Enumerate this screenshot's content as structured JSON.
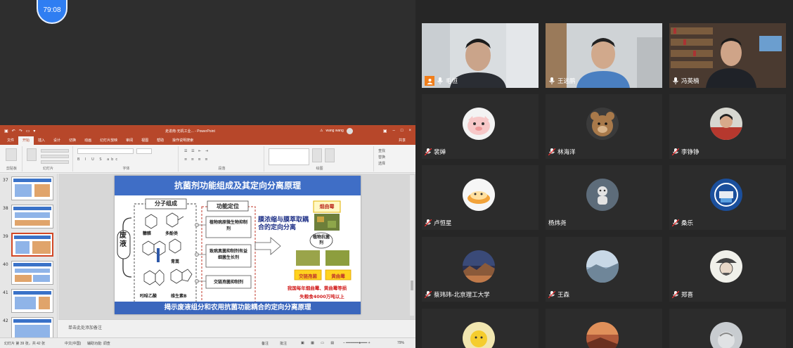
{
  "timer": "79:08",
  "ppt": {
    "doc_title": "走进南·无机工业...  -  PowerPoint",
    "account": "wang wang",
    "tabs": [
      "文件",
      "开始",
      "插入",
      "设计",
      "切换",
      "动画",
      "幻灯片放映",
      "审阅",
      "视图",
      "帮助",
      "操作说明搜索"
    ],
    "share_label": "共享",
    "groups": [
      "剪贴板",
      "幻灯片",
      "字体",
      "段落",
      "绘图"
    ],
    "find_label": "查找",
    "replace_label": "替换",
    "select_label": "选择",
    "slide_numbers": [
      "37",
      "38",
      "39",
      "40",
      "41",
      "42"
    ],
    "slide": {
      "title": "抗菌剂功能组成及其定向分离原理",
      "footer": "揭示废液组分和农用抗菌功能耦合的定向分离原理",
      "waste_label": "废液",
      "molecular_header": "分子组成",
      "mol_labels": [
        "糠醛",
        "多酚类",
        "青蒿",
        "吲哚乙酸",
        "维生素B"
      ],
      "function_header": "功能定位",
      "functions": [
        "植物病原微生物抑制剂",
        "致病真菌抑制剂有益细菌生长剂",
        "交链孢菌抑制剂"
      ],
      "process_text": "膜浓缩与膜萃取耦合的定向分离",
      "product_label": "烟曲霉",
      "antibacterial_label": "植物抗菌剂",
      "fungi": [
        "交链孢菌",
        "黄曲霉"
      ],
      "loss_text_1": "我国每年烟曲霉、黄曲霉等损",
      "loss_text_2": "失粮食4000万吨以上"
    },
    "note_placeholder": "单击此处添加备注",
    "status": {
      "slide_pos": "幻灯片 第 39 张，共 42 张",
      "lang": "中文(中国)",
      "accessibility": "辅助功能: 调查",
      "notes": "备注",
      "comments": "批注",
      "zoom": "79%"
    }
  },
  "participants": [
    {
      "name": "毛恒",
      "type": "video"
    },
    {
      "name": "王远鹏",
      "type": "video"
    },
    {
      "name": "冯英楠",
      "type": "video"
    },
    {
      "name": "裴婵",
      "type": "avatar"
    },
    {
      "name": "林海洋",
      "type": "avatar"
    },
    {
      "name": "李铮铮",
      "type": "avatar"
    },
    {
      "name": "卢恒星",
      "type": "avatar"
    },
    {
      "name": "杨炜尧",
      "type": "avatar"
    },
    {
      "name": "桑乐",
      "type": "avatar"
    },
    {
      "name": "蔡玮玮-北京理工大学",
      "type": "avatar"
    },
    {
      "name": "王森",
      "type": "avatar"
    },
    {
      "name": "郑喜",
      "type": "avatar"
    }
  ],
  "colors": {
    "accent": "#2f7ef2",
    "ppt_red": "#b7472a",
    "slide_blue": "#3f6ec6",
    "host_badge": "#f07e1b"
  }
}
